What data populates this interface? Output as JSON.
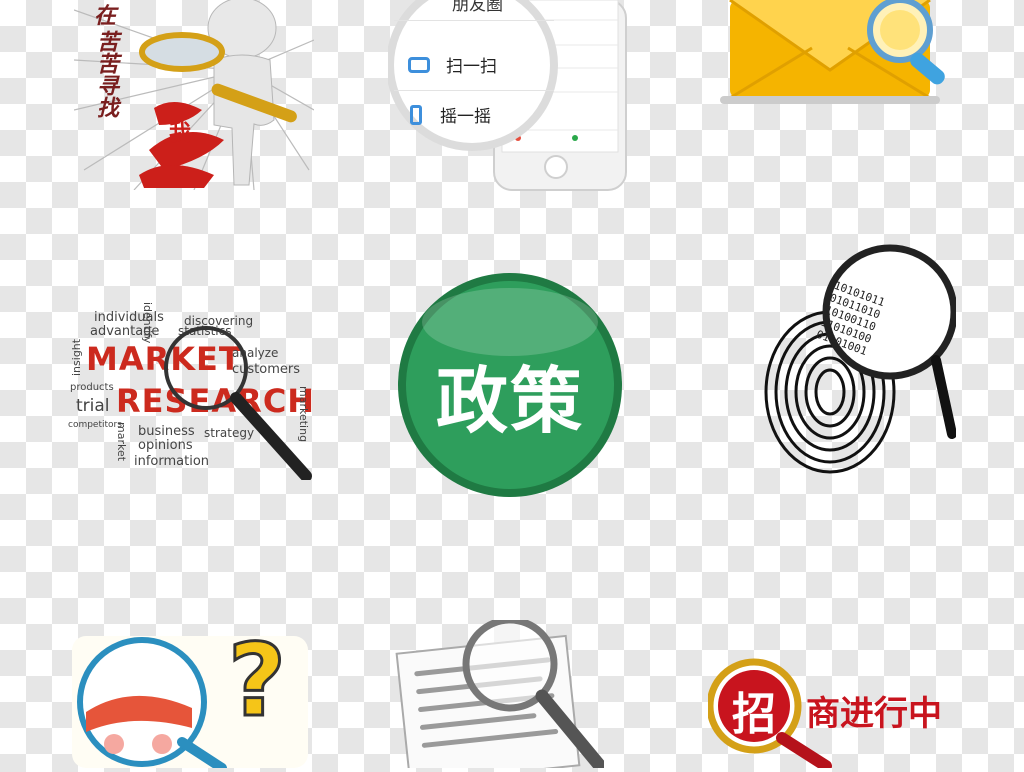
{
  "search_figure": {
    "vertical_text": "苦苦寻找",
    "first_char": "在",
    "red_graffiti": "我",
    "colors": {
      "red": "#cc1f1a",
      "gold": "#d4a017",
      "text": "#7a1f1f"
    }
  },
  "phone_menu": {
    "top_item": "朋友圈",
    "item_scan": "扫一扫",
    "item_shake": "摇一摇",
    "icons": [
      "scan-icon",
      "shake-icon"
    ]
  },
  "mail_search": {
    "icons": [
      "envelope-icon",
      "magnifier-icon"
    ],
    "colors": {
      "envelope": "#f5b400",
      "lens": "#3fa3e0"
    }
  },
  "market_research": {
    "headline_1": "MARKET",
    "headline_2": "RESEARCH",
    "words": {
      "individuals": "individuals",
      "advantage": "advantage",
      "discovering": "discovering",
      "statistics": "statistics",
      "identify": "identify",
      "insight": "insight",
      "analyze": "analyze",
      "customers": "customers",
      "products": "products",
      "trial": "trial",
      "marketing": "marketing",
      "competitors": "competitors",
      "business": "business",
      "strategy": "strategy",
      "opinions": "opinions",
      "information": "information",
      "market": "market"
    }
  },
  "policy_badge": {
    "text": "政策",
    "color": "#2e9e5c"
  },
  "fingerprint": {
    "binary_lines": [
      "10101011",
      "01011010",
      "10100110",
      "11010100",
      "01101001"
    ]
  },
  "cartoon_girl": {
    "question_mark": "?",
    "color": "#f5c518"
  },
  "document_search": {
    "icons": [
      "document-icon",
      "magnifier-icon"
    ]
  },
  "recruiting": {
    "badge_char": "招",
    "rest_text": "商进行中",
    "color": "#c8141e"
  }
}
